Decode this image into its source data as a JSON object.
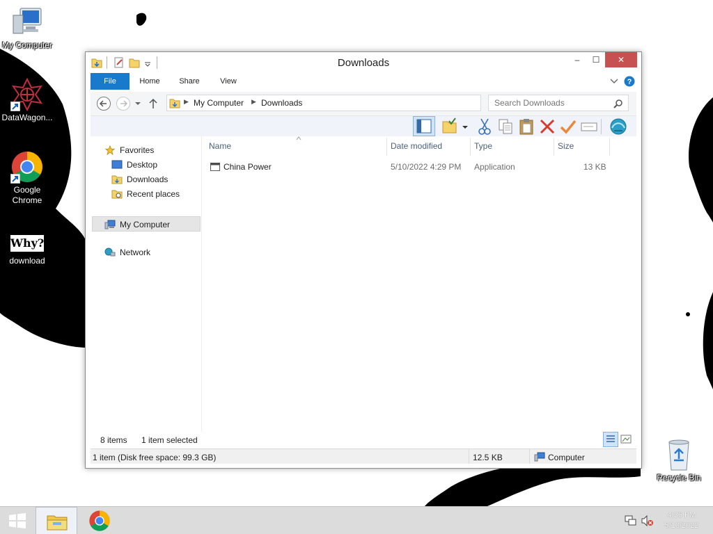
{
  "desktop": {
    "icons": [
      {
        "label": "My Computer",
        "icon": "computer-icon"
      },
      {
        "label": "DataWagon...",
        "icon": "datawagon-icon"
      },
      {
        "label": "Google Chrome",
        "icon": "chrome-icon"
      },
      {
        "label": "download",
        "icon": "why-image-icon",
        "image_text": "Why?"
      },
      {
        "label": "Recycle Bin",
        "icon": "recycle-bin-icon"
      }
    ]
  },
  "window": {
    "title": "Downloads",
    "controls": {
      "minimize": "‒",
      "maximize": "☐",
      "close": "✕"
    },
    "ribbon_tabs": [
      "File",
      "Home",
      "Share",
      "View"
    ],
    "address": {
      "segments": [
        "My Computer",
        "Downloads"
      ]
    },
    "search": {
      "placeholder": "Search Downloads"
    },
    "nav_pane": {
      "favorites": "Favorites",
      "favorites_items": [
        "Desktop",
        "Downloads",
        "Recent places"
      ],
      "my_computer": "My Computer",
      "network": "Network"
    },
    "columns": {
      "name": "Name",
      "date": "Date modified",
      "type": "Type",
      "size": "Size"
    },
    "files": [
      {
        "name": "China Power",
        "date": "5/10/2022 4:29 PM",
        "type": "Application",
        "size": "13 KB"
      }
    ],
    "status": {
      "items": "8 items",
      "selected": "1 item selected",
      "bottom_left": "1 item (Disk free space: 99.3 GB)",
      "bottom_size": "12.5 KB",
      "bottom_location": "Computer"
    }
  },
  "taskbar": {
    "time": "4:36 PM",
    "date": "5/10/2022"
  },
  "colors": {
    "accent": "#1979ca",
    "close_button": "#c75050",
    "header_text": "#4c607a"
  }
}
